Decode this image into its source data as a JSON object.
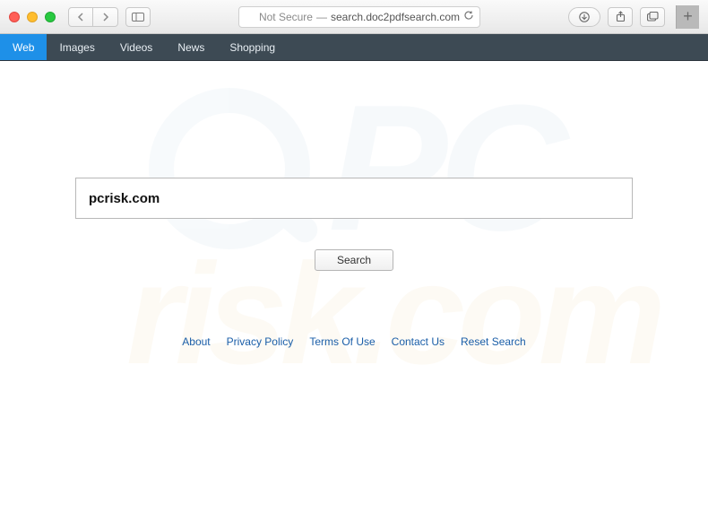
{
  "browser": {
    "not_secure": "Not Secure",
    "separator": " — ",
    "url": "search.doc2pdfsearch.com"
  },
  "nav": {
    "tabs": [
      {
        "label": "Web",
        "active": true
      },
      {
        "label": "Images",
        "active": false
      },
      {
        "label": "Videos",
        "active": false
      },
      {
        "label": "News",
        "active": false
      },
      {
        "label": "Shopping",
        "active": false
      }
    ]
  },
  "search": {
    "value": "pcrisk.com",
    "button": "Search"
  },
  "footer": {
    "links": [
      "About",
      "Privacy Policy",
      "Terms Of Use",
      "Contact Us",
      "Reset Search"
    ]
  },
  "watermark": {
    "line1": "PC",
    "line2": "risk.com"
  }
}
